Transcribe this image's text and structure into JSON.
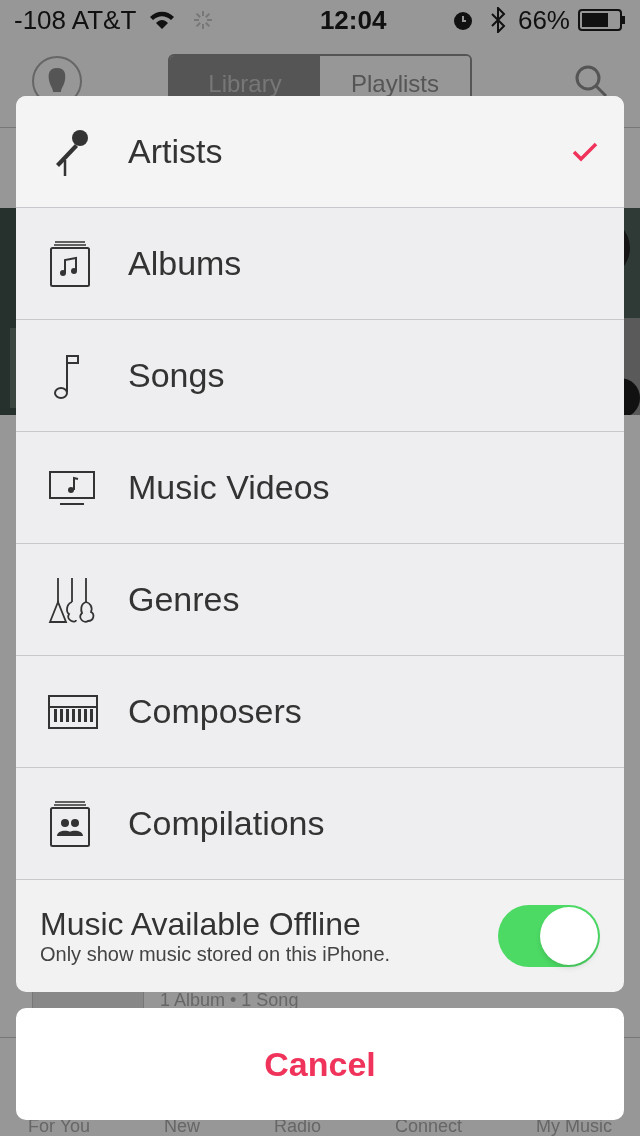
{
  "status_bar": {
    "carrier": "-108 AT&T",
    "time": "12:04",
    "battery": "66%"
  },
  "nav": {
    "tabs": [
      {
        "label": "Library",
        "selected": true
      },
      {
        "label": "Playlists",
        "selected": false
      }
    ]
  },
  "background_row": {
    "subtitle": "1 Album • 1 Song"
  },
  "tab_bar": [
    "For You",
    "New",
    "Radio",
    "Connect",
    "My Music"
  ],
  "menu": {
    "items": [
      {
        "label": "Artists",
        "selected": true
      },
      {
        "label": "Albums",
        "selected": false
      },
      {
        "label": "Songs",
        "selected": false
      },
      {
        "label": "Music Videos",
        "selected": false
      },
      {
        "label": "Genres",
        "selected": false
      },
      {
        "label": "Composers",
        "selected": false
      },
      {
        "label": "Compilations",
        "selected": false
      }
    ],
    "offline": {
      "title": "Music Available Offline",
      "subtitle": "Only show music stored on this iPhone.",
      "on": true
    }
  },
  "cancel": "Cancel"
}
